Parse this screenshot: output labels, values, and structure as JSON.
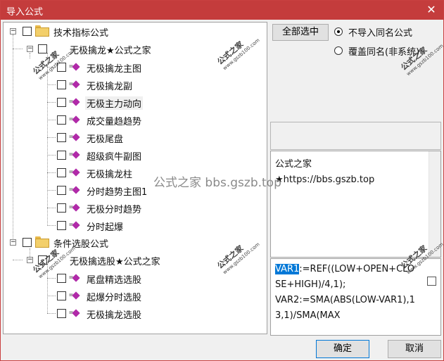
{
  "window": {
    "title": "导入公式",
    "close_glyph": "✕"
  },
  "tree": {
    "groups": [
      {
        "label": "技术指标公式",
        "sub": {
          "label": "无极擒龙★公式之家",
          "items": [
            "无极擒龙主图",
            "无极擒龙副",
            "无极主力动向",
            "成交量趋趋势",
            "无极尾盘",
            "超级疯牛副图",
            "无极擒龙柱",
            "分时趋势主图1",
            "无极分时趋势",
            "分时起爆"
          ]
        }
      },
      {
        "label": "条件选股公式",
        "sub": {
          "label": "无极擒选股★公式之家",
          "items": [
            "尾盘精选选股",
            "起爆分时选股",
            "无极擒龙选股"
          ]
        }
      }
    ]
  },
  "controls": {
    "select_all_label": "全部选中",
    "radio_skip_label": "不导入同名公式",
    "radio_overwrite_label": "覆盖同名(非系统)",
    "radio_selected": "skip"
  },
  "description": {
    "line1": "公式之家",
    "line2": "★https://bbs.gszb.top"
  },
  "code": {
    "highlighted": "VAR1",
    "rest": ":=REF((LOW+OPEN+CLOSE+HIGH)/4,1);\nVAR2:=SMA(ABS(LOW-VAR1),13,1)/SMA(MAX"
  },
  "footer": {
    "ok_label": "确定",
    "cancel_label": "取消"
  },
  "watermarks": {
    "stamp_text": "公式之家",
    "stamp_url": "www.gszb100.com",
    "center_text": "公式之家 bbs.gszb.top"
  }
}
